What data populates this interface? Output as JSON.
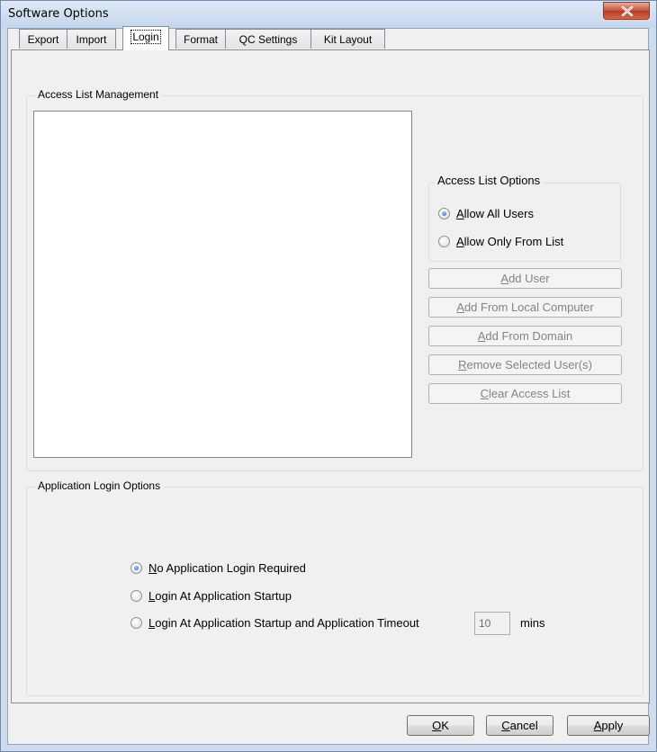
{
  "window": {
    "title": "Software Options"
  },
  "tabs": [
    {
      "label": "Export",
      "active": false
    },
    {
      "label": "Import",
      "active": false
    },
    {
      "label": "Login",
      "active": true
    },
    {
      "label": "Format",
      "active": false
    },
    {
      "label": "QC Settings",
      "active": false
    },
    {
      "label": "Kit Layout",
      "active": false
    }
  ],
  "access_list_management": {
    "title": "Access List Management",
    "user_list": [],
    "options": {
      "title": "Access List Options",
      "radios": [
        {
          "label": "Allow All Users",
          "mnemonic": "A",
          "rest": "llow All Users",
          "checked": true
        },
        {
          "label": "Allow Only From List",
          "mnemonic": "A",
          "rest": "llow Only From List",
          "checked": false
        }
      ]
    },
    "buttons": [
      {
        "label": "Add User",
        "mnemonic": "A",
        "rest": "dd User",
        "enabled": false
      },
      {
        "label": "Add From Local Computer",
        "mnemonic": "A",
        "rest": "dd From Local Computer",
        "enabled": false
      },
      {
        "label": "Add From Domain",
        "mnemonic": "A",
        "rest": "dd From Domain",
        "enabled": false
      },
      {
        "label": "Remove Selected User(s)",
        "mnemonic": "R",
        "rest": "emove Selected User(s)",
        "enabled": false
      },
      {
        "label": "Clear Access List",
        "mnemonic": "C",
        "rest": "lear Access List",
        "enabled": false
      }
    ]
  },
  "application_login_options": {
    "title": "Application Login Options",
    "radios": [
      {
        "label": "No Application Login Required",
        "mnemonic": "N",
        "rest": "o Application Login Required",
        "checked": true
      },
      {
        "label": "Login At Application Startup",
        "mnemonic": "L",
        "rest": "ogin At Application Startup",
        "checked": false
      },
      {
        "label": "Login At Application Startup and Application Timeout",
        "mnemonic": "L",
        "rest": "ogin At Application Startup and Application Timeout",
        "checked": false
      }
    ],
    "timeout_value": "10",
    "timeout_unit": "mins"
  },
  "footer": {
    "ok": {
      "label": "OK",
      "mnemonic": "O",
      "rest": "K"
    },
    "cancel": {
      "label": "Cancel",
      "mnemonic": "C",
      "rest": "ancel"
    },
    "apply": {
      "label": "Apply",
      "mnemonic": "A",
      "rest": "pply"
    }
  },
  "colors": {
    "titlebar": "#c4d6ec",
    "close_button": "#c7523b",
    "radio_selected": "#1c59c4",
    "disabled_text": "#838383"
  }
}
